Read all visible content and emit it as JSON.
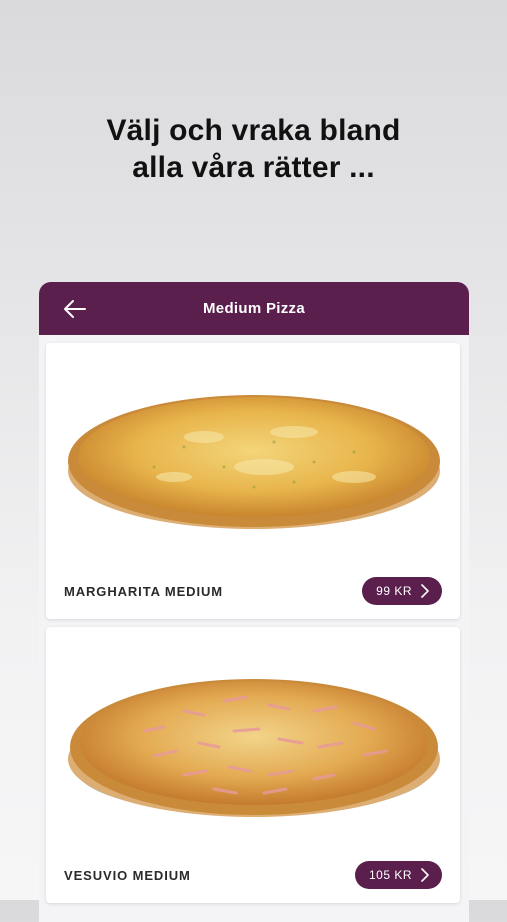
{
  "promo": {
    "headline_line1": "Välj och vraka bland",
    "headline_line2": "alla våra rätter ..."
  },
  "appbar": {
    "title": "Medium Pizza",
    "back_icon": "arrow-left-icon"
  },
  "colors": {
    "brand": "#5b1f4d",
    "card": "#ffffff"
  },
  "menu_items": [
    {
      "name": "MARGHARITA MEDIUM",
      "price": "99 KR",
      "topping": "cheese"
    },
    {
      "name": "VESUVIO MEDIUM",
      "price": "105 KR",
      "topping": "ham"
    }
  ]
}
